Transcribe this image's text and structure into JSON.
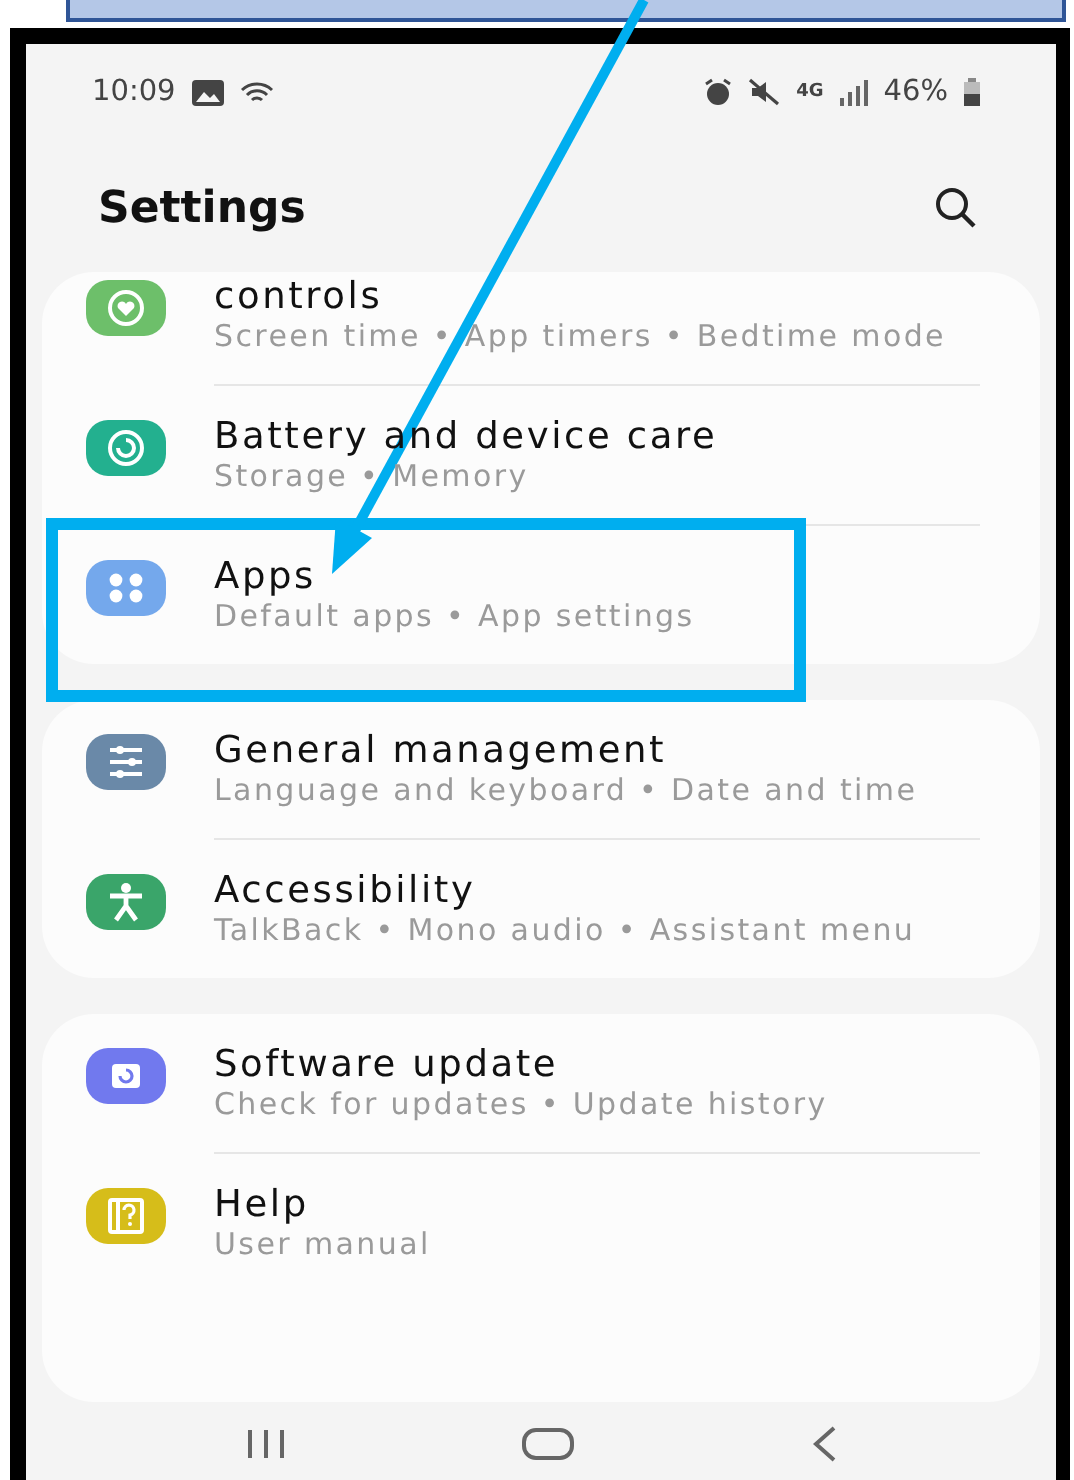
{
  "status_bar": {
    "time": "10:09",
    "network": "4G",
    "battery": "46%"
  },
  "title": "Settings",
  "groups": [
    {
      "items": [
        {
          "kind": "wellbeing",
          "color": "#6dbf6a",
          "title": "controls",
          "subtitle": "Screen time  •  App timers  •  Bedtime mode",
          "highlighted": false
        },
        {
          "kind": "battery",
          "color": "#23b08f",
          "title": "Battery and device care",
          "subtitle": "Storage  •  Memory",
          "highlighted": false
        },
        {
          "kind": "apps",
          "color": "#74a8ec",
          "title": "Apps",
          "subtitle": "Default apps  •  App settings",
          "highlighted": true
        }
      ]
    },
    {
      "items": [
        {
          "kind": "general",
          "color": "#6a89a8",
          "title": "General management",
          "subtitle": "Language and keyboard  •  Date and time",
          "highlighted": false
        },
        {
          "kind": "accessibility",
          "color": "#3aa56a",
          "title": "Accessibility",
          "subtitle": "TalkBack  •  Mono audio  •  Assistant menu",
          "highlighted": false
        }
      ]
    },
    {
      "items": [
        {
          "kind": "update",
          "color": "#7179ee",
          "title": "Software update",
          "subtitle": "Check for updates  •  Update history",
          "highlighted": false
        },
        {
          "kind": "help",
          "color": "#d6bd1a",
          "title": "Help",
          "subtitle": "User manual",
          "highlighted": false
        }
      ]
    }
  ]
}
